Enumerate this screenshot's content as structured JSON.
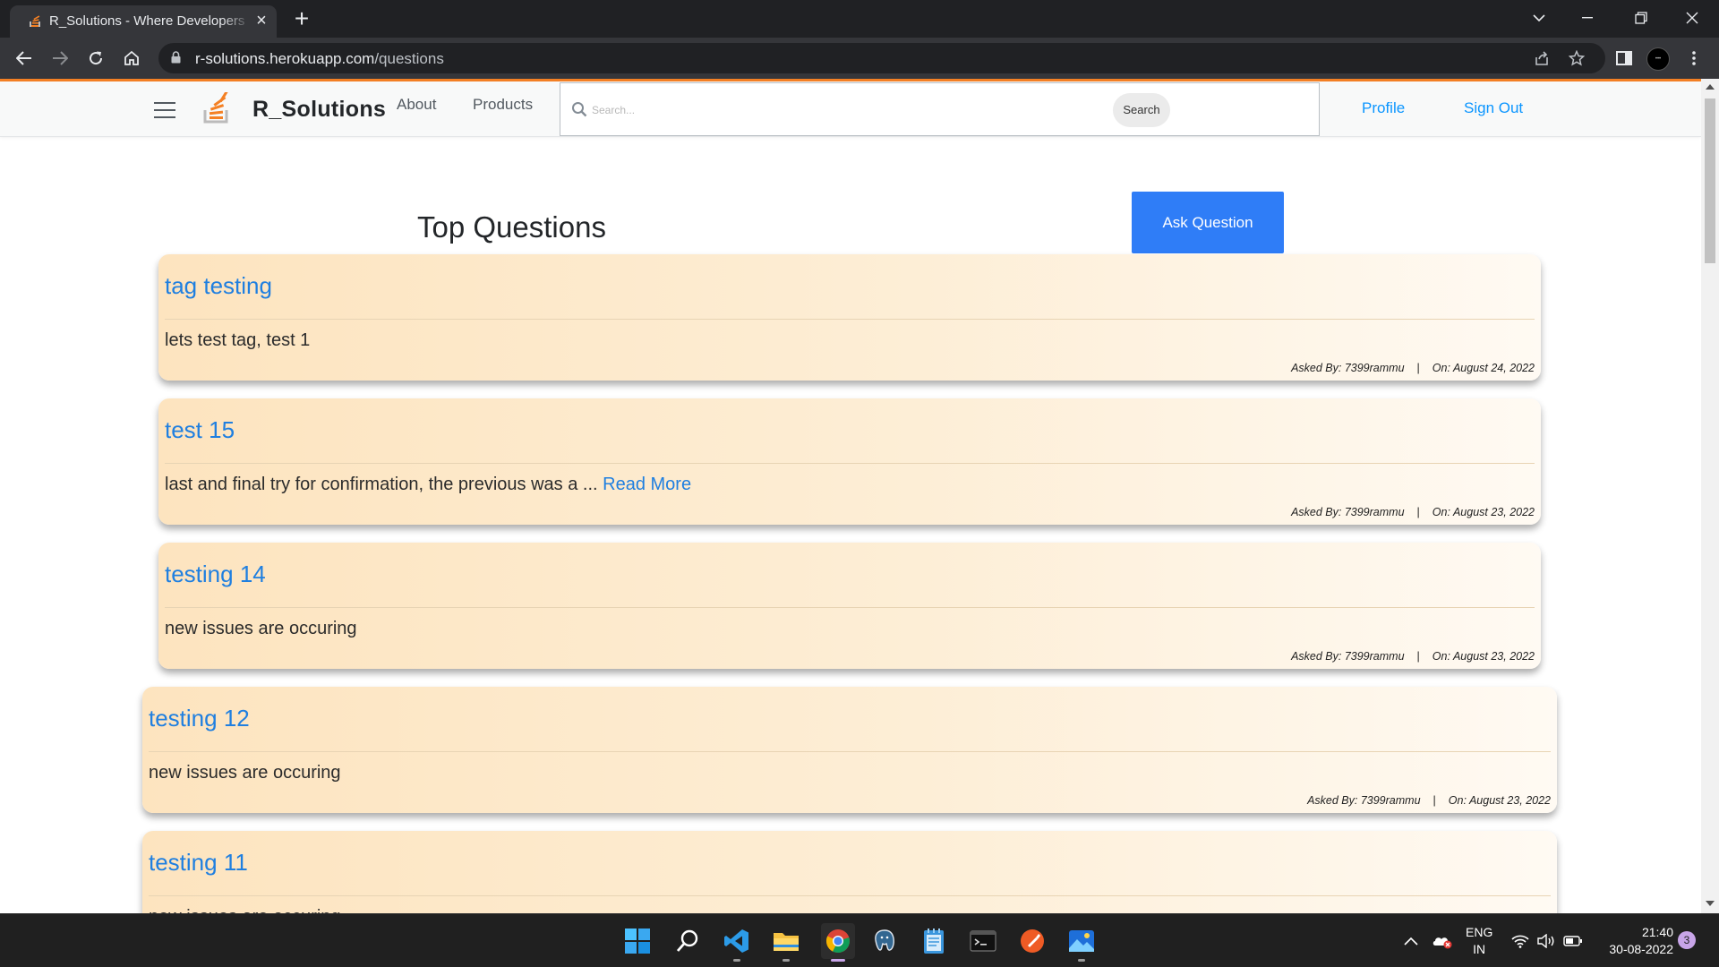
{
  "browser": {
    "tab_title": "R_Solutions - Where Developers Learn",
    "url_host": "r-solutions.herokuapp.com",
    "url_path": "/questions"
  },
  "navbar": {
    "brand": "R_Solutions",
    "links": [
      "About",
      "Products"
    ],
    "search_placeholder": "Search...",
    "search_button": "Search",
    "profile": "Profile",
    "sign_out": "Sign Out"
  },
  "main": {
    "title": "Top Questions",
    "ask_button": "Ask Question",
    "asked_prefix": "Asked By:",
    "on_prefix": "On:",
    "questions": [
      {
        "title": "tag testing",
        "body": "lets test tag, test 1",
        "read_more": "",
        "author": "7399rammu",
        "date": "August 24, 2022"
      },
      {
        "title": "test 15",
        "body": "last and final try for confirmation, the previous was a ... ",
        "read_more": "Read More",
        "author": "7399rammu",
        "date": "August 23, 2022"
      },
      {
        "title": "testing 14",
        "body": "new issues are occuring",
        "read_more": "",
        "author": "7399rammu",
        "date": "August 23, 2022"
      },
      {
        "title": "testing 12",
        "body": "new issues are occuring",
        "read_more": "",
        "author": "7399rammu",
        "date": "August 23, 2022"
      },
      {
        "title": "testing 11",
        "body": "new issues are occuring",
        "read_more": "",
        "author": "7399rammu",
        "date": ""
      }
    ]
  },
  "taskbar": {
    "lang_top": "ENG",
    "lang_bottom": "IN",
    "time": "21:40",
    "date": "30-08-2022",
    "notification_count": "3"
  },
  "colors": {
    "accent_orange": "#f48024",
    "link_blue": "#1f7fe0",
    "ask_button": "#2f7df7"
  }
}
